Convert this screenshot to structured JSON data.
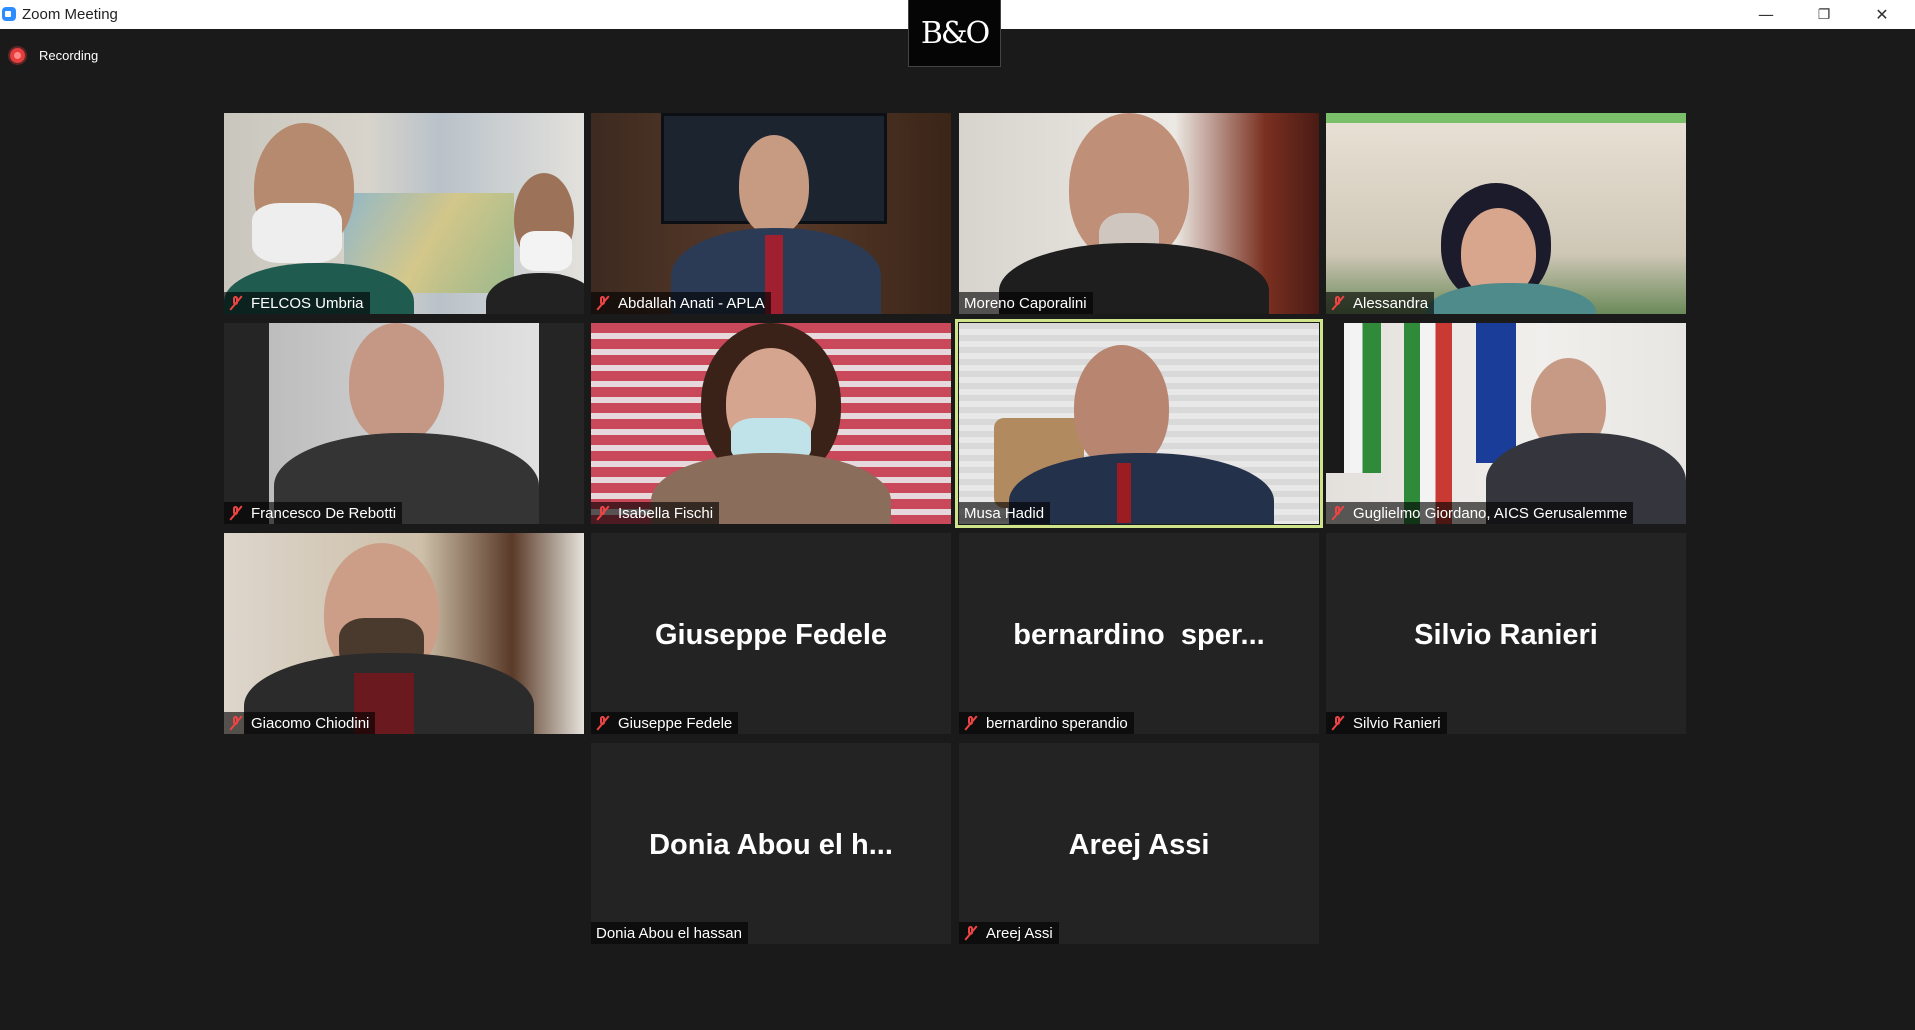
{
  "window": {
    "title": "Zoom Meeting",
    "minimize_glyph": "—",
    "maximize_glyph": "❐",
    "close_glyph": "✕",
    "logo_text": "B&O"
  },
  "recording": {
    "label": "Recording"
  },
  "participants": [
    {
      "label": "FELCOS Umbria",
      "muted": true,
      "video": true
    },
    {
      "label": "Abdallah Anati - APLA",
      "muted": true,
      "video": true
    },
    {
      "label": "Moreno Caporalini",
      "muted": false,
      "video": true
    },
    {
      "label": "Alessandra",
      "muted": true,
      "video": true
    },
    {
      "label": "Francesco De Rebotti",
      "muted": true,
      "video": true
    },
    {
      "label": "Isabella Fischi",
      "muted": true,
      "video": true
    },
    {
      "label": "Musa Hadid",
      "muted": false,
      "video": true,
      "active_speaker": true
    },
    {
      "label": "Guglielmo Giordano, AICS Gerusalemme",
      "muted": true,
      "video": true
    },
    {
      "label": "Giacomo Chiodini",
      "muted": true,
      "video": true
    },
    {
      "label": "Giuseppe Fedele",
      "display_name": "Giuseppe Fedele",
      "muted": true,
      "video": false
    },
    {
      "label": "bernardino sperandio",
      "display_name": "bernardino  sper...",
      "muted": true,
      "video": false
    },
    {
      "label": "Silvio Ranieri",
      "display_name": "Silvio Ranieri",
      "muted": true,
      "video": false
    },
    {
      "label": "Donia Abou el hassan",
      "display_name": "Donia Abou el h...",
      "muted": false,
      "video": false
    },
    {
      "label": "Areej Assi",
      "display_name": "Areej Assi",
      "muted": true,
      "video": false
    }
  ]
}
